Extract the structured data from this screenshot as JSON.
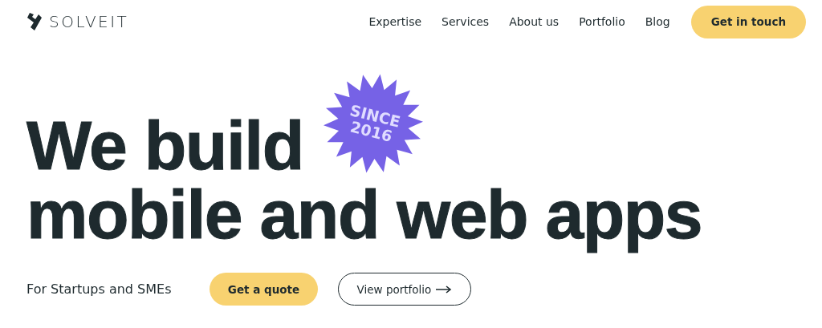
{
  "header": {
    "logo": "SOLVEIT",
    "nav": [
      {
        "label": "Expertise"
      },
      {
        "label": "Services"
      },
      {
        "label": "About us"
      },
      {
        "label": "Portfolio"
      },
      {
        "label": "Blog"
      }
    ],
    "cta": "Get in touch"
  },
  "hero": {
    "headline_lines": [
      "We build",
      "mobile and web apps"
    ],
    "badge": [
      "SINCE",
      "2016"
    ],
    "tagline": "For Startups and SMEs",
    "primary_button": "Get a quote",
    "secondary_button": "View portfolio"
  }
}
